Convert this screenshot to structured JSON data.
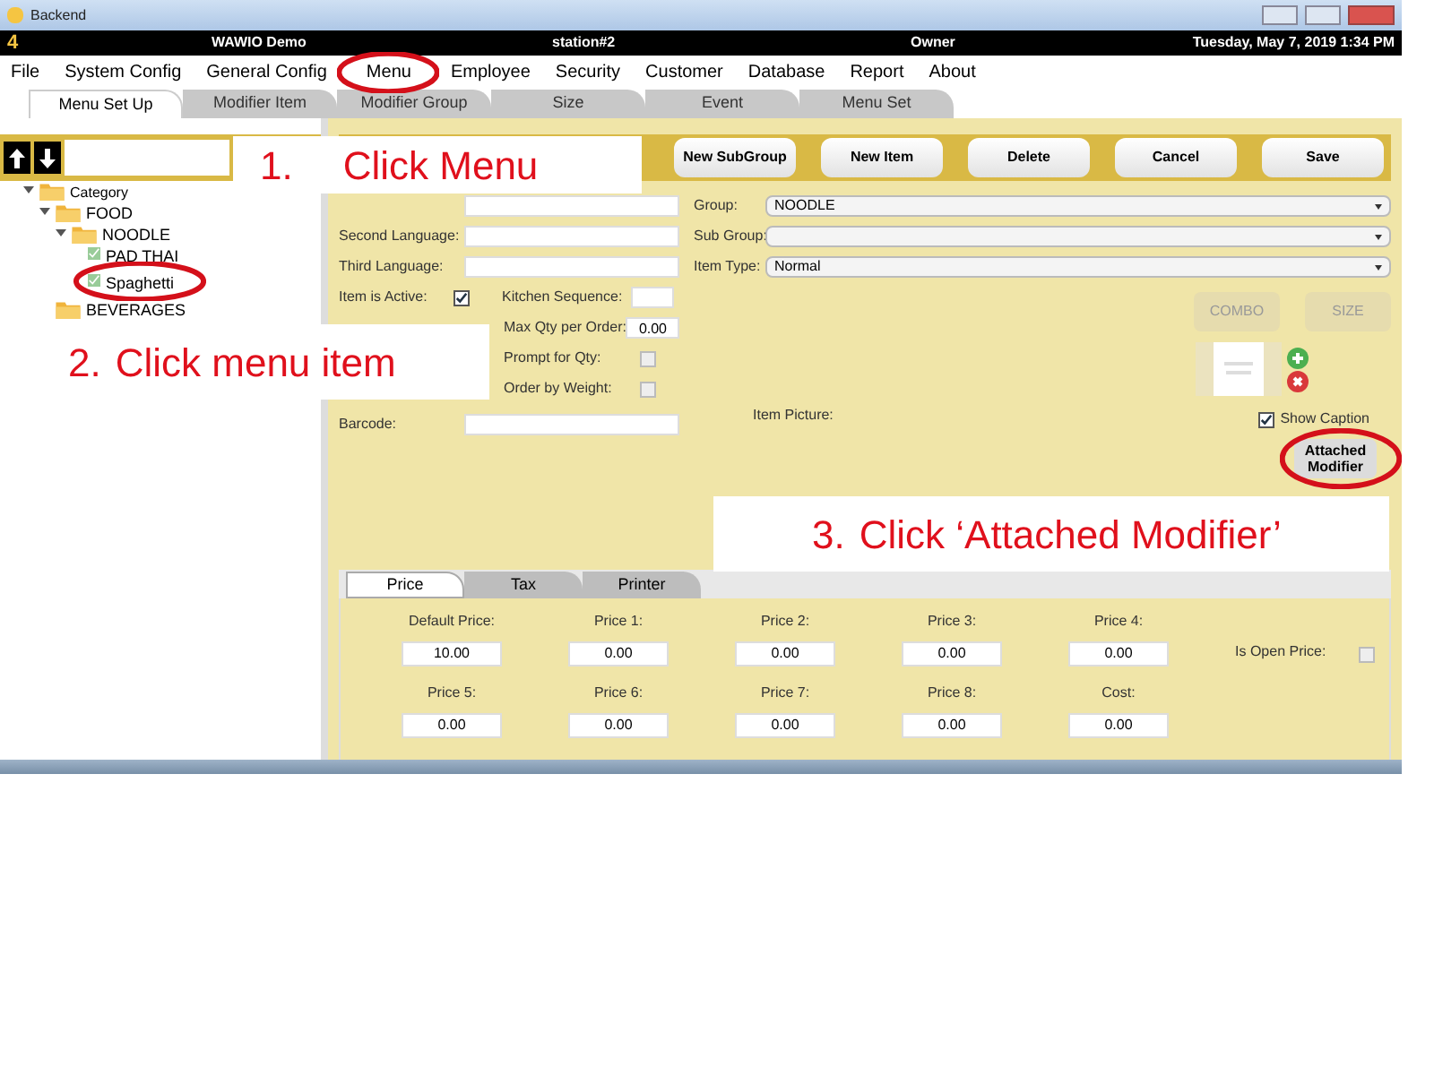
{
  "window": {
    "title": "Backend"
  },
  "header": {
    "logo": "4",
    "app": "WAWIO Demo",
    "station": "station#2",
    "user": "Owner",
    "datetime": "Tuesday, May 7, 2019 1:34 PM"
  },
  "menu": [
    {
      "label": "File",
      "highlighted": false
    },
    {
      "label": "System Config",
      "highlighted": false
    },
    {
      "label": "General Config",
      "highlighted": false
    },
    {
      "label": "Menu",
      "highlighted": true
    },
    {
      "label": "Employee",
      "highlighted": false
    },
    {
      "label": "Security",
      "highlighted": false
    },
    {
      "label": "Customer",
      "highlighted": false
    },
    {
      "label": "Database",
      "highlighted": false
    },
    {
      "label": "Report",
      "highlighted": false
    },
    {
      "label": "About",
      "highlighted": false
    }
  ],
  "tabs": [
    {
      "label": "Menu Set Up",
      "selected": true
    },
    {
      "label": "Modifier Item",
      "selected": false
    },
    {
      "label": "Modifier Group",
      "selected": false
    },
    {
      "label": "Size",
      "selected": false
    },
    {
      "label": "Event",
      "selected": false
    },
    {
      "label": "Menu Set",
      "selected": false
    }
  ],
  "tree": [
    {
      "label": "Category",
      "kind": "folder",
      "highlighted": false,
      "children": [
        {
          "label": "FOOD",
          "kind": "folder",
          "highlighted": false,
          "children": [
            {
              "label": "NOODLE",
              "kind": "folder",
              "highlighted": false,
              "children": [
                {
                  "label": "PAD THAI",
                  "kind": "item",
                  "highlighted": false
                },
                {
                  "label": "Spaghetti",
                  "kind": "item",
                  "highlighted": true
                }
              ]
            }
          ]
        },
        {
          "label": "BEVERAGES",
          "kind": "folder",
          "highlighted": false
        }
      ]
    }
  ],
  "toolbar": [
    "New SubGroup",
    "New Item",
    "Delete",
    "Cancel",
    "Save"
  ],
  "form": {
    "second_language": {
      "label": "Second Language:"
    },
    "third_language": {
      "label": "Third Language:"
    },
    "item_active": {
      "label": "Item is Active:",
      "checked": true
    },
    "kitchen_sequence": {
      "label": "Kitchen Sequence:"
    },
    "max_qty": {
      "label": "Max Qty per Order:",
      "value": "0.00"
    },
    "prompt_qty": {
      "label": "Prompt for Qty:",
      "checked": false
    },
    "order_weight": {
      "label": "Order by Weight:",
      "checked": false
    },
    "barcode": {
      "label": "Barcode:"
    },
    "group": {
      "label": "Group:",
      "value": "NOODLE"
    },
    "sub_group": {
      "label": "Sub Group:"
    },
    "item_type": {
      "label": "Item Type:",
      "value": "Normal"
    },
    "item_picture": {
      "label": "Item Picture:"
    },
    "side_buttons": [
      "COMBO",
      "SIZE"
    ],
    "show_caption": {
      "label": "Show Caption",
      "checked": true
    },
    "attached_modifier": {
      "label": "Attached Modifier",
      "highlighted": true
    }
  },
  "price_tabs": [
    {
      "label": "Price",
      "selected": true
    },
    {
      "label": "Tax",
      "selected": false
    },
    {
      "label": "Printer",
      "selected": false
    }
  ],
  "prices": [
    {
      "label": "Default Price:",
      "value": "10.00"
    },
    {
      "label": "Price 1:",
      "value": "0.00"
    },
    {
      "label": "Price 2:",
      "value": "0.00"
    },
    {
      "label": "Price 3:",
      "value": "0.00"
    },
    {
      "label": "Price 4:",
      "value": "0.00"
    },
    {
      "label": "Price 5:",
      "value": "0.00"
    },
    {
      "label": "Price 6:",
      "value": "0.00"
    },
    {
      "label": "Price 7:",
      "value": "0.00"
    },
    {
      "label": "Price 8:",
      "value": "0.00"
    },
    {
      "label": "Cost:",
      "value": "0.00"
    }
  ],
  "open_price": {
    "label": "Is Open Price:",
    "checked": false
  },
  "annotations": [
    {
      "number": "1.",
      "text": "Click Menu"
    },
    {
      "number": "2.",
      "text": "Click menu item"
    },
    {
      "number": "3.",
      "text": "Click ‘Attached Modifier’"
    }
  ]
}
